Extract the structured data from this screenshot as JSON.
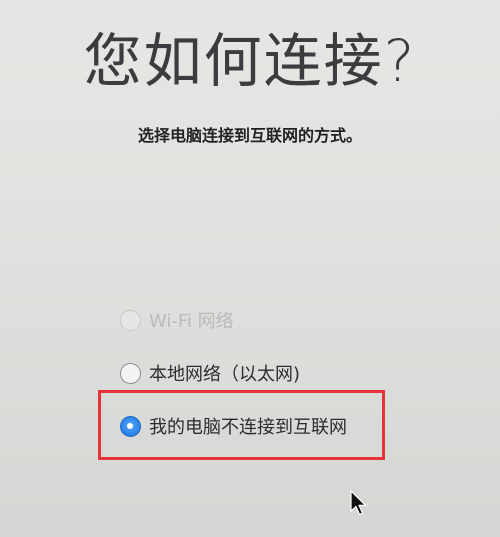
{
  "header": {
    "title": "您如何连接?",
    "subtitle": "选择电脑连接到互联网的方式。"
  },
  "options": [
    {
      "label": "Wi-Fi 网络",
      "state": "disabled",
      "selected": false
    },
    {
      "label": "本地网络（以太网)",
      "state": "enabled",
      "selected": false
    },
    {
      "label": "我的电脑不连接到互联网",
      "state": "enabled",
      "selected": true
    }
  ],
  "colors": {
    "highlight_border": "#e8323a",
    "radio_selected": "#2e86ec"
  },
  "icons": {
    "cursor": "mouse-pointer-icon"
  }
}
